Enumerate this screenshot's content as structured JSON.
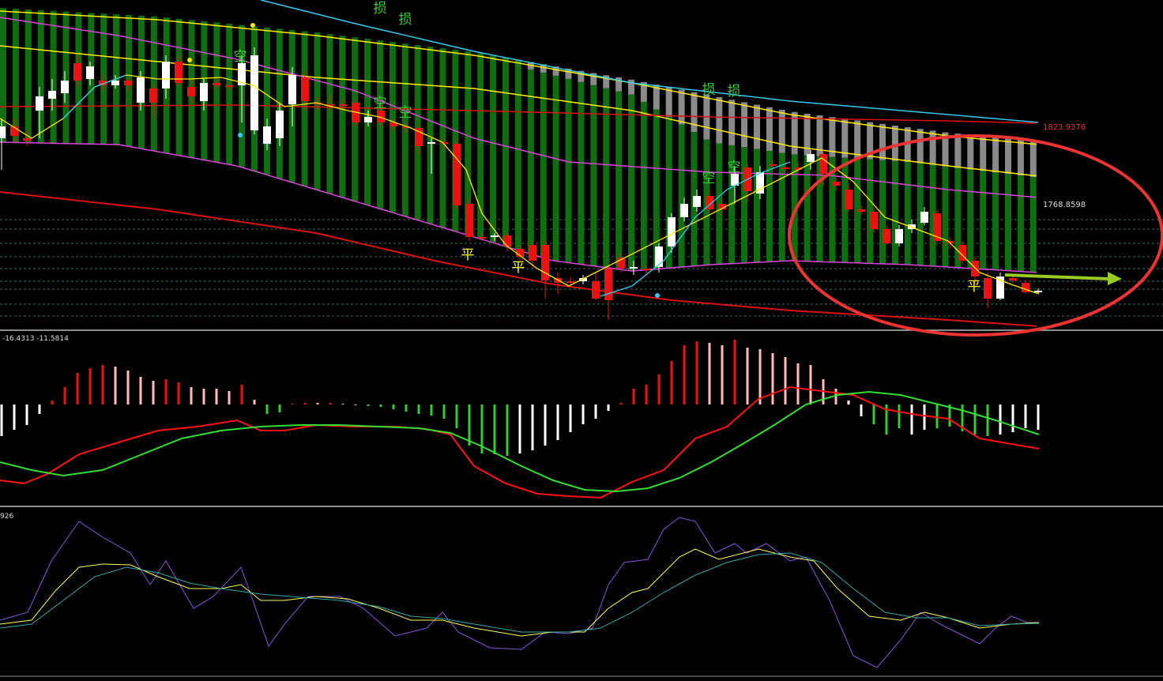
{
  "chart_data": [
    {
      "type": "candlestick",
      "panel": "price",
      "price_labels": {
        "upper": "1823.9376",
        "middle": "1768.8598"
      },
      "price_label_values": {
        "upper": 1823.9376,
        "middle": 1768.8598
      },
      "signal_labels": [
        {
          "text": "损",
          "color": "#39c93a",
          "bar": 29
        },
        {
          "text": "损",
          "color": "#39c93a",
          "bar": 31
        },
        {
          "text": "空",
          "color": "#39c93a",
          "bar": 18
        },
        {
          "text": "空",
          "color": "#39c93a",
          "bar": 29
        },
        {
          "text": "空",
          "color": "#39c93a",
          "bar": 31
        },
        {
          "text": "平",
          "color": "#ffff33",
          "bar": 36
        },
        {
          "text": "平",
          "color": "#ffff33",
          "bar": 40
        },
        {
          "text": "损",
          "color": "#39c93a",
          "bar": 55
        },
        {
          "text": "损",
          "color": "#39c93a",
          "bar": 57
        },
        {
          "text": "空",
          "color": "#39c93a",
          "bar": 55
        },
        {
          "text": "空",
          "color": "#39c93a",
          "bar": 57
        },
        {
          "text": "平",
          "color": "#ffff33",
          "bar": 76
        }
      ],
      "colors": {
        "bull": "#ffffff",
        "bear": "#ee1111",
        "ribbon_green": "#0f6e0f",
        "ribbon_gray": "#8a8a8a",
        "ma_yellow": "#ffee00",
        "ma_magenta": "#dd44dd",
        "ma_cyan": "#33ccee",
        "ma_red": "#dd1111",
        "annotation_ellipse": "#ee3333",
        "annotation_arrow": "#99cc22"
      }
    },
    {
      "type": "macd",
      "panel": "macd",
      "header_values": "-16.4313 -11.5814",
      "colors": {
        "hist_up_strong": "#ee1111",
        "hist_up_weak": "#ffbbbb",
        "hist_down_strong": "#33cc33",
        "hist_down_weak": "#ffffff",
        "line_fast": "#ff1111",
        "line_slow": "#33dd33"
      }
    },
    {
      "type": "line",
      "panel": "oscillator",
      "header_values": "926",
      "colors": {
        "fast": "#8855dd",
        "mid": "#ffff55",
        "slow": "#33aaaa"
      }
    }
  ]
}
